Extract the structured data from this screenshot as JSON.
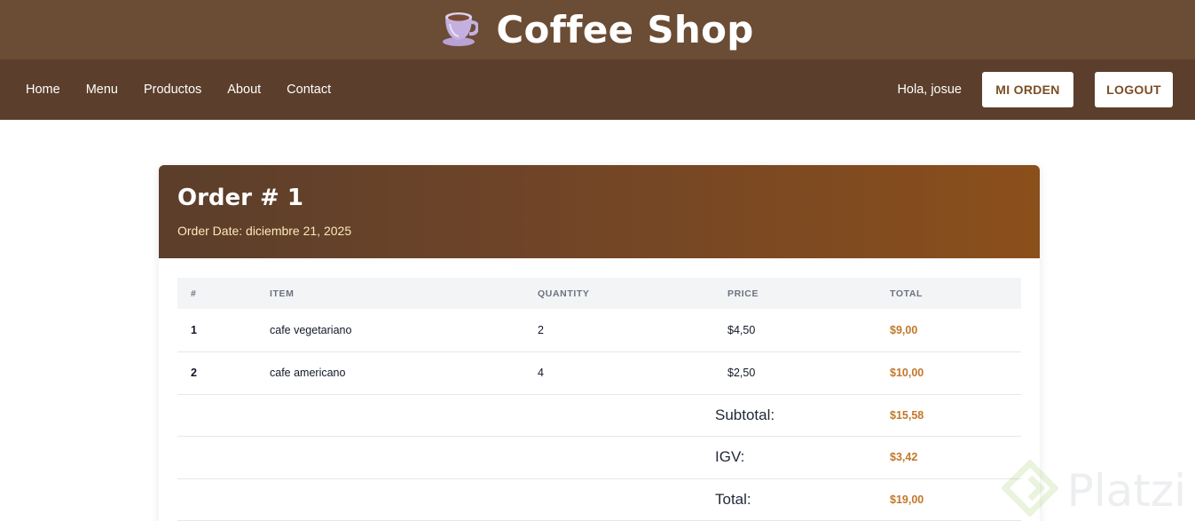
{
  "header": {
    "title": "Coffee Shop",
    "logo_icon": "coffee-cup-icon"
  },
  "nav": {
    "links": [
      "Home",
      "Menu",
      "Productos",
      "About",
      "Contact"
    ],
    "greeting": "Hola, josue",
    "order_button": "MI ORDEN",
    "logout_button": "LOGOUT"
  },
  "order": {
    "title": "Order # 1",
    "date": "Order Date: diciembre 21, 2025",
    "columns": [
      "#",
      "ITEM",
      "QUANTITY",
      "PRICE",
      "TOTAL"
    ],
    "rows": [
      {
        "num": "1",
        "item": "cafe vegetariano",
        "quantity": "2",
        "price": "$4,50",
        "total": "$9,00"
      },
      {
        "num": "2",
        "item": "cafe americano",
        "quantity": "4",
        "price": "$2,50",
        "total": "$10,00"
      }
    ],
    "subtotal_label": "Subtotal:",
    "subtotal_value": "$15,58",
    "igv_label": "IGV:",
    "igv_value": "$3,42",
    "total_label": "Total:",
    "total_value": "$19,00"
  },
  "watermark": {
    "text": "Platzi",
    "icon": "platzi-logo-icon"
  },
  "colors": {
    "brand_bar": "#6b4c35",
    "nav": "#5b3e2b",
    "accent_gold": "#c2782a"
  }
}
